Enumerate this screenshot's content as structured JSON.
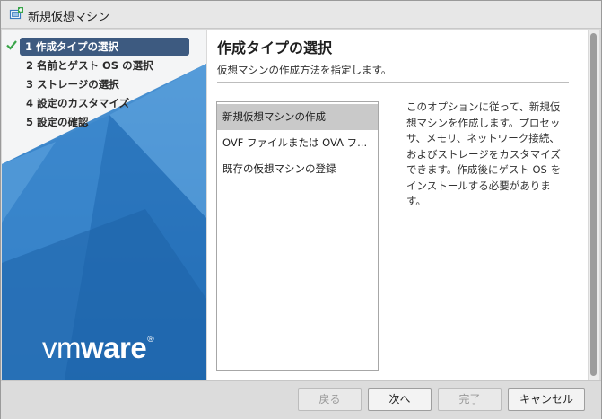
{
  "window": {
    "title": "新規仮想マシン",
    "icon": "new-vm-icon"
  },
  "steps": [
    {
      "label": "1 作成タイプの選択",
      "active": true
    },
    {
      "label": "2 名前とゲスト OS の選択",
      "active": false
    },
    {
      "label": "3 ストレージの選択",
      "active": false
    },
    {
      "label": "4 設定のカスタマイズ",
      "active": false
    },
    {
      "label": "5 設定の確認",
      "active": false
    }
  ],
  "logo": {
    "brand_light": "vm",
    "brand_bold": "ware",
    "reg": "®"
  },
  "main": {
    "title": "作成タイプの選択",
    "subtitle": "仮想マシンの作成方法を指定します。",
    "options": [
      "新規仮想マシンの作成",
      "OVF ファイルまたは OVA フ...",
      "既存の仮想マシンの登録"
    ],
    "selected_index": 0,
    "description": "このオプションに従って、新規仮想マシンを作成します。プロセッサ、メモリ、ネットワーク接続、およびストレージをカスタマイズできます。作成後にゲスト OS をインストールする必要があります。"
  },
  "footer": {
    "back": "戻る",
    "next": "次へ",
    "finish": "完了",
    "cancel": "キャンセル"
  },
  "colors": {
    "accent": "#3d5a80",
    "panel_blue": "#2f7bc0",
    "selected_option": "#c9c9c9"
  }
}
